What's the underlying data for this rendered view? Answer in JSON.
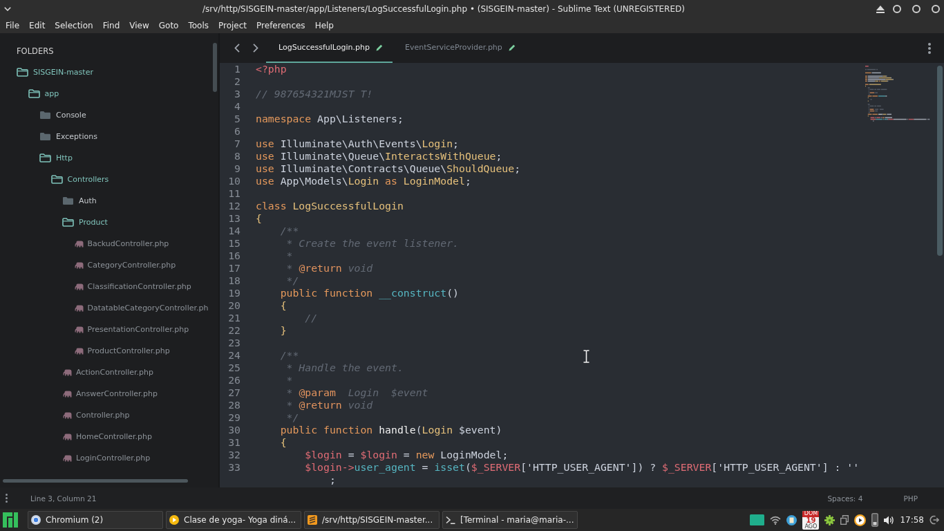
{
  "window": {
    "title": "/srv/http/SISGEIN-master/app/Listeners/LogSuccessfulLogin.php • (SISGEIN-master) - Sublime Text (UNREGISTERED)"
  },
  "menu": [
    "File",
    "Edit",
    "Selection",
    "Find",
    "View",
    "Goto",
    "Tools",
    "Project",
    "Preferences",
    "Help"
  ],
  "sidebar": {
    "heading": "FOLDERS",
    "tree": [
      {
        "kind": "folder",
        "name": "SISGEIN-master",
        "expanded": true,
        "children": [
          {
            "kind": "folder",
            "name": "app",
            "expanded": true,
            "children": [
              {
                "kind": "folder",
                "name": "Console",
                "expanded": false
              },
              {
                "kind": "folder",
                "name": "Exceptions",
                "expanded": false
              },
              {
                "kind": "folder",
                "name": "Http",
                "expanded": true,
                "children": [
                  {
                    "kind": "folder",
                    "name": "Controllers",
                    "expanded": true,
                    "children": [
                      {
                        "kind": "folder",
                        "name": "Auth",
                        "expanded": false
                      },
                      {
                        "kind": "folder",
                        "name": "Product",
                        "expanded": true,
                        "children": [
                          {
                            "kind": "file",
                            "name": "BackudController.php"
                          },
                          {
                            "kind": "file",
                            "name": "CategoryController.php"
                          },
                          {
                            "kind": "file",
                            "name": "ClassificationController.php"
                          },
                          {
                            "kind": "file",
                            "name": "DatatableCategoryController.ph"
                          },
                          {
                            "kind": "file",
                            "name": "PresentationController.php"
                          },
                          {
                            "kind": "file",
                            "name": "ProductController.php"
                          }
                        ]
                      },
                      {
                        "kind": "file",
                        "name": "ActionController.php"
                      },
                      {
                        "kind": "file",
                        "name": "AnswerController.php"
                      },
                      {
                        "kind": "file",
                        "name": "Controller.php"
                      },
                      {
                        "kind": "file",
                        "name": "HomeController.php"
                      },
                      {
                        "kind": "file",
                        "name": "LoginController.php"
                      }
                    ]
                  }
                ]
              }
            ]
          }
        ]
      }
    ]
  },
  "editor": {
    "tabs": [
      {
        "label": "LogSuccessfulLogin.php",
        "selected": true,
        "modified": true
      },
      {
        "label": "EventServiceProvider.php",
        "selected": false,
        "modified": true
      }
    ],
    "lines": [
      {
        "number": "1",
        "tokens": [
          {
            "kind": "tag",
            "text": "<?php"
          }
        ]
      },
      {
        "number": "2"
      },
      {
        "number": "3",
        "tokens": [
          {
            "kind": "comment",
            "text": "// 987654321MJST T!"
          }
        ]
      },
      {
        "number": "4"
      },
      {
        "number": "5",
        "tokens": [
          {
            "kind": "keyword",
            "text": "namespace"
          },
          {
            "kind": "plain",
            "text": " App\\Listeners;"
          }
        ]
      },
      {
        "number": "6"
      },
      {
        "number": "7",
        "tokens": [
          {
            "kind": "keyword",
            "text": "use"
          },
          {
            "kind": "plain",
            "text": " Illuminate\\Auth\\Events\\"
          },
          {
            "kind": "class",
            "text": "Login"
          },
          {
            "kind": "plain",
            "text": ";"
          }
        ]
      },
      {
        "number": "8",
        "tokens": [
          {
            "kind": "keyword",
            "text": "use"
          },
          {
            "kind": "plain",
            "text": " Illuminate\\Queue\\"
          },
          {
            "kind": "class",
            "text": "InteractsWithQueue"
          },
          {
            "kind": "plain",
            "text": ";"
          }
        ]
      },
      {
        "number": "9",
        "tokens": [
          {
            "kind": "keyword",
            "text": "use"
          },
          {
            "kind": "plain",
            "text": " Illuminate\\Contracts\\Queue\\"
          },
          {
            "kind": "class",
            "text": "ShouldQueue"
          },
          {
            "kind": "plain",
            "text": ";"
          }
        ]
      },
      {
        "number": "10",
        "tokens": [
          {
            "kind": "keyword",
            "text": "use"
          },
          {
            "kind": "plain",
            "text": " App\\Models\\"
          },
          {
            "kind": "class",
            "text": "Login"
          },
          {
            "kind": "keyword",
            "text": " as "
          },
          {
            "kind": "class",
            "text": "LoginModel"
          },
          {
            "kind": "plain",
            "text": ";"
          }
        ]
      },
      {
        "number": "11"
      },
      {
        "number": "12",
        "tokens": [
          {
            "kind": "keyword",
            "text": "class "
          },
          {
            "kind": "class",
            "text": "LogSuccessfulLogin"
          }
        ]
      },
      {
        "number": "13",
        "tokens": [
          {
            "kind": "brace",
            "text": "{"
          }
        ]
      },
      {
        "number": "14",
        "tokens": [
          {
            "kind": "comment",
            "text": "    /**"
          }
        ]
      },
      {
        "number": "15",
        "tokens": [
          {
            "kind": "comment",
            "text": "     * Create the event listener."
          }
        ]
      },
      {
        "number": "16",
        "tokens": [
          {
            "kind": "comment",
            "text": "     *"
          }
        ]
      },
      {
        "number": "17",
        "tokens": [
          {
            "kind": "comment",
            "text": "     * "
          },
          {
            "kind": "doctag",
            "text": "@return"
          },
          {
            "kind": "comment",
            "text": " void"
          }
        ]
      },
      {
        "number": "18",
        "tokens": [
          {
            "kind": "comment",
            "text": "     */"
          }
        ]
      },
      {
        "number": "19",
        "tokens": [
          {
            "kind": "keyword",
            "text": "    public function "
          },
          {
            "kind": "method",
            "text": "__construct"
          },
          {
            "kind": "plain",
            "text": "()"
          }
        ]
      },
      {
        "number": "20",
        "tokens": [
          {
            "kind": "brace",
            "text": "    {"
          }
        ]
      },
      {
        "number": "21",
        "tokens": [
          {
            "kind": "comment",
            "text": "        //"
          }
        ]
      },
      {
        "number": "22",
        "tokens": [
          {
            "kind": "brace",
            "text": "    }"
          }
        ]
      },
      {
        "number": "23"
      },
      {
        "number": "24",
        "tokens": [
          {
            "kind": "comment",
            "text": "    /**"
          }
        ]
      },
      {
        "number": "25",
        "tokens": [
          {
            "kind": "comment",
            "text": "     * Handle the event."
          }
        ]
      },
      {
        "number": "26",
        "tokens": [
          {
            "kind": "comment",
            "text": "     *"
          }
        ]
      },
      {
        "number": "27",
        "tokens": [
          {
            "kind": "comment",
            "text": "     * "
          },
          {
            "kind": "doctag",
            "text": "@param"
          },
          {
            "kind": "comment",
            "text": "  Login  $event"
          }
        ]
      },
      {
        "number": "28",
        "tokens": [
          {
            "kind": "comment",
            "text": "     * "
          },
          {
            "kind": "doctag",
            "text": "@return"
          },
          {
            "kind": "comment",
            "text": " void"
          }
        ]
      },
      {
        "number": "29",
        "tokens": [
          {
            "kind": "comment",
            "text": "     */"
          }
        ]
      },
      {
        "number": "30",
        "tokens": [
          {
            "kind": "keyword",
            "text": "    public function "
          },
          {
            "kind": "name",
            "text": "handle"
          },
          {
            "kind": "plain",
            "text": "("
          },
          {
            "kind": "class",
            "text": "Login"
          },
          {
            "kind": "plain",
            "text": " $event)"
          }
        ]
      },
      {
        "number": "31",
        "tokens": [
          {
            "kind": "brace",
            "text": "    {"
          }
        ]
      },
      {
        "number": "32",
        "tokens": [
          {
            "kind": "variable",
            "text": "        $login"
          },
          {
            "kind": "plain",
            "text": " = "
          },
          {
            "kind": "variable",
            "text": "$login"
          },
          {
            "kind": "plain",
            "text": " = "
          },
          {
            "kind": "keyword",
            "text": "new"
          },
          {
            "kind": "plain",
            "text": " LoginModel;"
          }
        ]
      },
      {
        "number": "33",
        "tokens": [
          {
            "kind": "variable",
            "text": "        $login->"
          },
          {
            "kind": "method",
            "text": "user_agent"
          },
          {
            "kind": "plain",
            "text": " = "
          },
          {
            "kind": "method",
            "text": "isset"
          },
          {
            "kind": "plain",
            "text": "("
          },
          {
            "kind": "variable",
            "text": "$_SERVER"
          },
          {
            "kind": "plain",
            "text": "['HTTP_USER_AGENT']) ? "
          },
          {
            "kind": "variable",
            "text": "$_SERVER"
          },
          {
            "kind": "plain",
            "text": "['HTTP_USER_AGENT'] : ''"
          }
        ],
        "continuation": [
          {
            "kind": "plain",
            "text": "            ;"
          }
        ]
      }
    ]
  },
  "status_bar": {
    "position": "Line 3, Column 21",
    "indentation": "Spaces: 4",
    "syntax": "PHP"
  },
  "taskbar": {
    "tasks": [
      {
        "kind": "browser",
        "label": "Chromium (2)"
      },
      {
        "kind": "media",
        "label": "Clase de yoga- Yoga diná..."
      },
      {
        "kind": "editor",
        "label": "/srv/http/SISGEIN-master..."
      },
      {
        "kind": "terminal",
        "label": "[Terminal - maria@maria-..."
      }
    ],
    "calendar": {
      "weekday": "DOM",
      "day": "19",
      "month": "AGO"
    },
    "clock": "17:58"
  }
}
